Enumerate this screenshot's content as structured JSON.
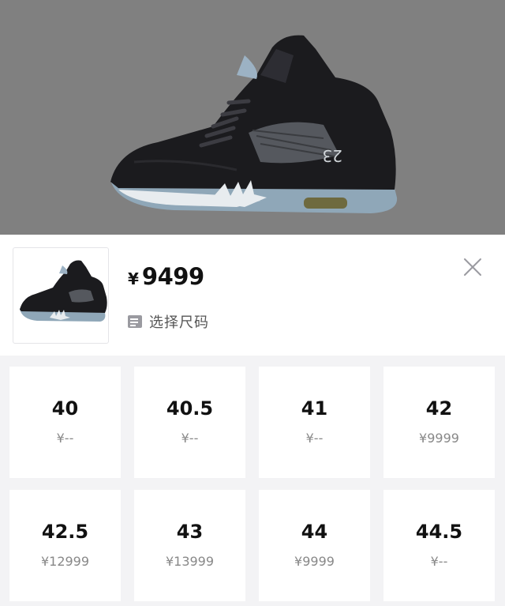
{
  "product": {
    "currency_symbol": "¥",
    "price": "9499",
    "select_size_label": "选择尺码",
    "shoe_number": "23"
  },
  "sizes": [
    {
      "size": "40",
      "price": "¥--"
    },
    {
      "size": "40.5",
      "price": "¥--"
    },
    {
      "size": "41",
      "price": "¥--"
    },
    {
      "size": "42",
      "price": "¥9999"
    },
    {
      "size": "42.5",
      "price": "¥12999"
    },
    {
      "size": "43",
      "price": "¥13999"
    },
    {
      "size": "44",
      "price": "¥9999"
    },
    {
      "size": "44.5",
      "price": "¥--"
    }
  ],
  "icons": {
    "close": "close-icon",
    "size_chart": "ruler-icon"
  },
  "colors": {
    "backdrop": "#808080",
    "sheet": "#ffffff",
    "grid_bg": "#f3f3f5",
    "price_text": "#111111",
    "muted_text": "#888888"
  }
}
